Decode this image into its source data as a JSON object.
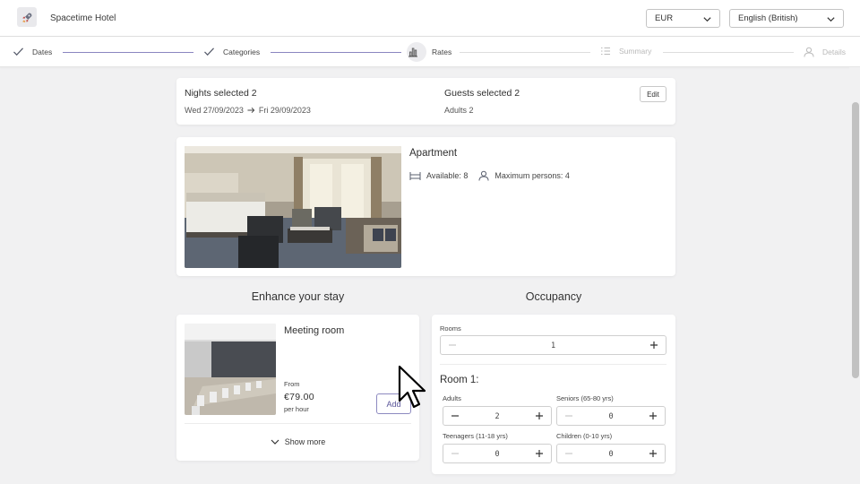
{
  "header": {
    "logo_icon": "rocket-icon",
    "hotel_name": "Spacetime Hotel",
    "currency": "EUR",
    "language": "English (British)"
  },
  "stepper": {
    "steps": [
      {
        "label": "Dates",
        "state": "done",
        "icon": "check-icon"
      },
      {
        "label": "Categories",
        "state": "done",
        "icon": "check-icon"
      },
      {
        "label": "Rates",
        "state": "current",
        "icon": "bar-chart-icon"
      },
      {
        "label": "Summary",
        "state": "todo",
        "icon": "list-icon"
      },
      {
        "label": "Details",
        "state": "todo",
        "icon": "user-icon"
      }
    ]
  },
  "summary": {
    "nights_label": "Nights selected 2",
    "date_from": "Wed 27/09/2023",
    "date_to": "Fri 29/09/2023",
    "guests_label": "Guests selected 2",
    "guests_detail": "Adults 2",
    "edit_label": "Edit"
  },
  "room": {
    "title": "Apartment",
    "available": "Available: 8",
    "max_persons": "Maximum persons: 4"
  },
  "enhance": {
    "section_title": "Enhance your stay",
    "item_title": "Meeting room",
    "from_label": "From",
    "price": "€79.00",
    "per_label": "per hour",
    "add_label": "Add",
    "show_more": "Show more"
  },
  "occupancy": {
    "section_title": "Occupancy",
    "rooms_label": "Rooms",
    "rooms_value": "1",
    "room_heading": "Room 1:",
    "adults_label": "Adults",
    "adults_value": "2",
    "seniors_label": "Seniors (65-80 yrs)",
    "seniors_value": "0",
    "teenagers_label": "Teenagers (11-18 yrs)",
    "teenagers_value": "0",
    "children_label": "Children (0-10 yrs)",
    "children_value": "0"
  },
  "colors": {
    "accent": "#8a86c0",
    "accent_text": "#5a5599",
    "background": "#f1f1f2"
  }
}
